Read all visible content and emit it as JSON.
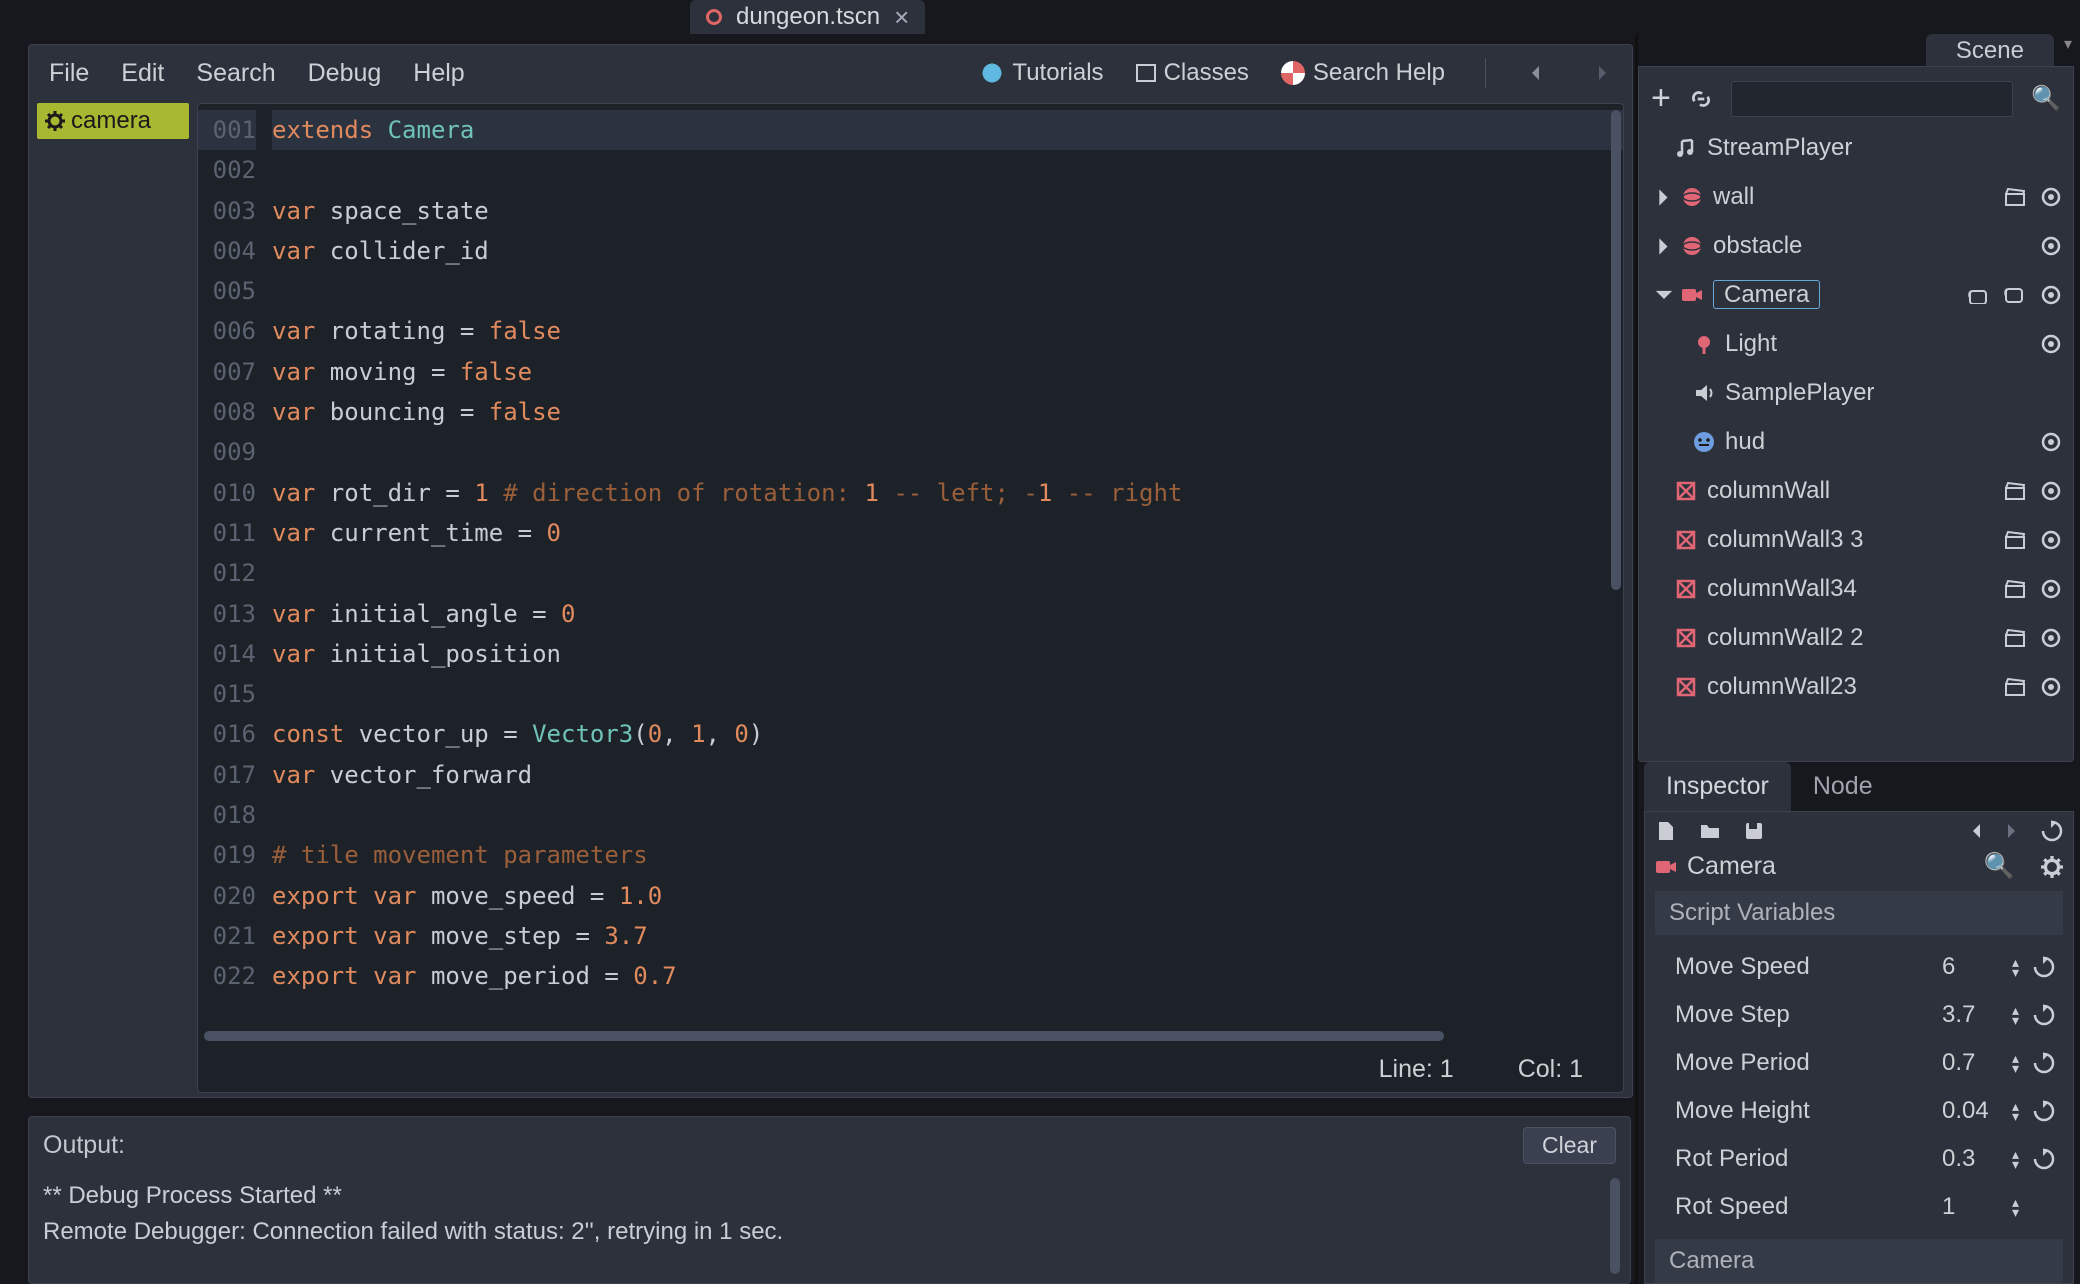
{
  "tab": {
    "filename": "dungeon.tscn"
  },
  "menubar": {
    "file": "File",
    "edit": "Edit",
    "search": "Search",
    "debug": "Debug",
    "help": "Help",
    "tutorials": "Tutorials",
    "classes": "Classes",
    "search_help": "Search Help"
  },
  "script_tab": {
    "label": "camera"
  },
  "code": {
    "lines": [
      "extends Camera",
      "",
      "var space_state",
      "var collider_id",
      "",
      "var rotating = false",
      "var moving = false",
      "var bouncing = false",
      "",
      "var rot_dir = 1 # direction of rotation: 1 -- left; -1 -- right",
      "var current_time = 0",
      "",
      "var initial_angle = 0",
      "var initial_position",
      "",
      "const vector_up = Vector3(0, 1, 0)",
      "var vector_forward",
      "",
      "# tile movement parameters",
      "export var move_speed = 1.0",
      "export var move_step = 3.7",
      "export var move_period = 0.7"
    ]
  },
  "status": {
    "line_label": "Line: 1",
    "col_label": "Col: 1"
  },
  "output": {
    "title": "Output:",
    "clear": "Clear",
    "lines": [
      "** Debug Process Started **",
      "Remote Debugger: Connection failed with status: 2'', retrying in 1 sec."
    ]
  },
  "scene": {
    "title": "Scene",
    "nodes": {
      "stream": "StreamPlayer",
      "wall": "wall",
      "obstacle": "obstacle",
      "camera": "Camera",
      "light": "Light",
      "sample": "SamplePlayer",
      "hud": "hud",
      "columnWall": "columnWall",
      "columnWall33": "columnWall3 3",
      "columnWall34": "columnWall34",
      "columnWall22": "columnWall2 2",
      "columnWall23": "columnWall23"
    }
  },
  "inspector": {
    "tabs": {
      "inspector": "Inspector",
      "node": "Node"
    },
    "node_label": "Camera",
    "group_scriptvars": "Script Variables",
    "group_camera": "Camera",
    "props": {
      "move_speed": {
        "label": "Move Speed",
        "value": "6"
      },
      "move_step": {
        "label": "Move Step",
        "value": "3.7"
      },
      "move_period": {
        "label": "Move Period",
        "value": "0.7"
      },
      "move_height": {
        "label": "Move Height",
        "value": "0.04"
      },
      "rot_period": {
        "label": "Rot Period",
        "value": "0.3"
      },
      "rot_speed": {
        "label": "Rot Speed",
        "value": "1"
      }
    }
  }
}
